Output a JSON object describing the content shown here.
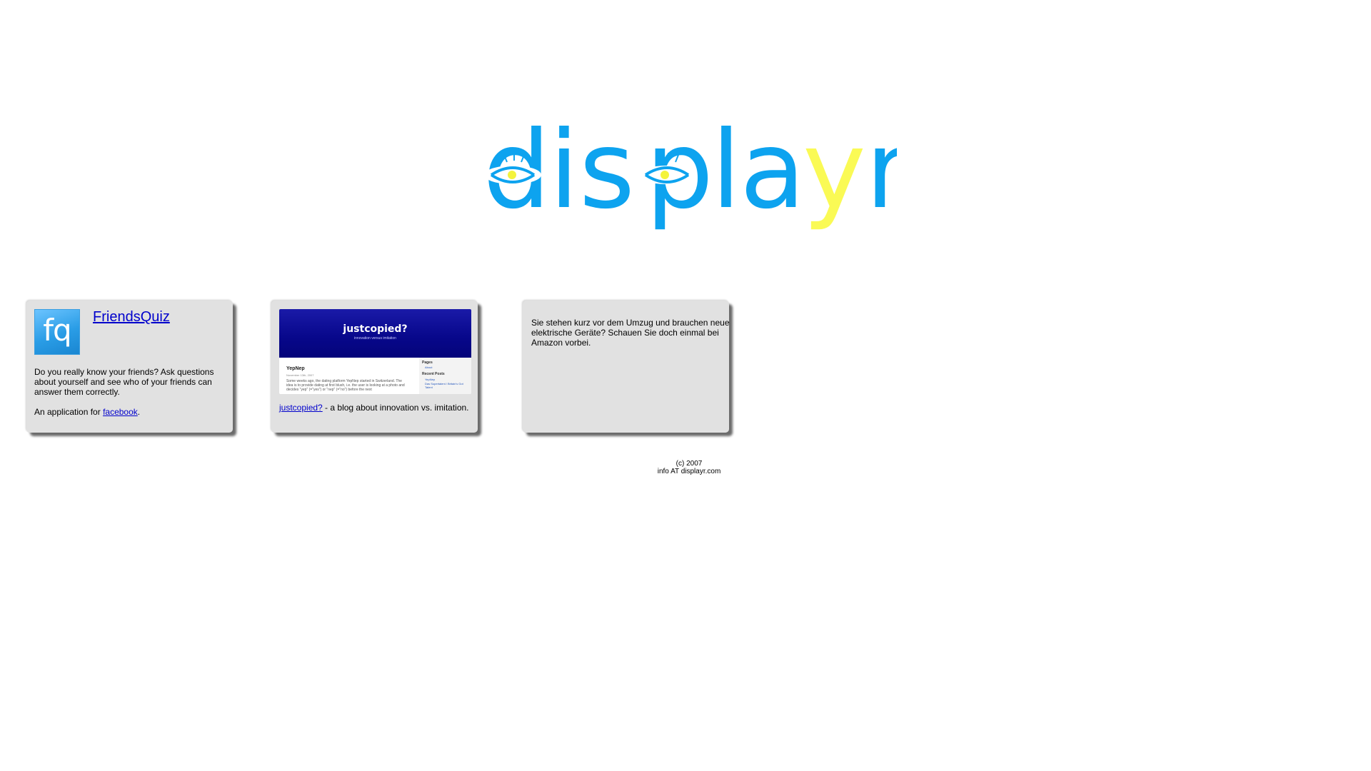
{
  "logo": {
    "text": "displayr",
    "letters": [
      "d",
      "i",
      "s",
      "p",
      "l",
      "a",
      "y",
      "r"
    ],
    "primary_color": "#0da3ef",
    "accent_color": "#fafa55",
    "eye_pupil_color": "#f4f33c"
  },
  "cards": {
    "friendsquiz": {
      "logo_text": "fq",
      "title": "FriendsQuiz",
      "description": "Do you really know your friends? Ask questions about yourself and see who of your friends can answer them correctly.",
      "app_prefix": "An application for ",
      "app_link": "facebook",
      "app_suffix": "."
    },
    "justcopied": {
      "screenshot": {
        "header_title": "justcopied?",
        "header_subtitle": "innovation versus imitation",
        "post_title": "YepNep",
        "post_date": "November 13th, 2007",
        "post_body": "Some weeks ago, the dating platform YepNep started in Switzerland. The idea is to provide dating at first blush, i.e. the user is looking at a photo and decides \"yep\" (=\"yes\") or \"nep\" (=\"no\") before the next",
        "sidebar_pages": "Pages",
        "sidebar_about": "About",
        "sidebar_recent": "Recent Posts",
        "sidebar_post1": "YepNep",
        "sidebar_post2": "Das Supertalent / Britain's Got Talent"
      },
      "link": "justcopied?",
      "caption_suffix": " - a blog about innovation vs. imitation."
    },
    "amazon": {
      "text": "Sie stehen kurz vor dem Umzug und brauchen neue elektrische Geräte? Schauen Sie doch einmal bei Amazon vorbei."
    }
  },
  "footer": {
    "copyright": "(c) 2007",
    "contact": "info AT displayr.com"
  }
}
